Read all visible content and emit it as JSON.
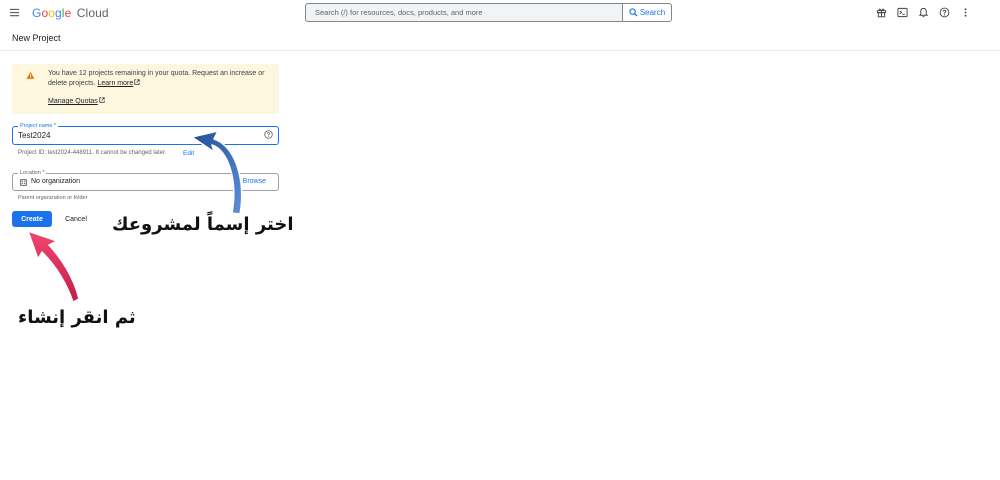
{
  "header": {
    "logo_parts": [
      "G",
      "o",
      "o",
      "g",
      "l",
      "e"
    ],
    "logo_product": "Cloud",
    "search_placeholder": "Search (/) for resources, docs, products, and more",
    "search_button": "Search",
    "icons": [
      "menu-icon",
      "gift-icon",
      "terminal-icon",
      "bell-icon",
      "help-icon",
      "more-vert-icon"
    ]
  },
  "page": {
    "title": "New Project"
  },
  "quota": {
    "text": "You have 12 projects remaining in your quota. Request an increase or delete projects.",
    "learn_more": "Learn more",
    "manage_quotas": "Manage Quotas",
    "icon": "warning-icon",
    "bg_color": "#fef7e0"
  },
  "form": {
    "project_name_label": "Project name *",
    "project_name_value": "Test2024",
    "project_id_text": "Project ID: test2024-448911. It cannot be changed later.",
    "edit_label": "Edit",
    "location_label": "Location *",
    "location_value": "No organization",
    "browse_label": "Browse",
    "location_hint": "Parent organization or folder",
    "create_label": "Create",
    "cancel_label": "Cancel"
  },
  "annotations": {
    "choose_name": "اختر إسماً لمشروعك",
    "then_create": "ثم انقر إنشاء",
    "blue_arrow_color": "#3a6fb5",
    "red_arrow_color": "#e8365d"
  },
  "colors": {
    "accent": "#1a73e8"
  }
}
